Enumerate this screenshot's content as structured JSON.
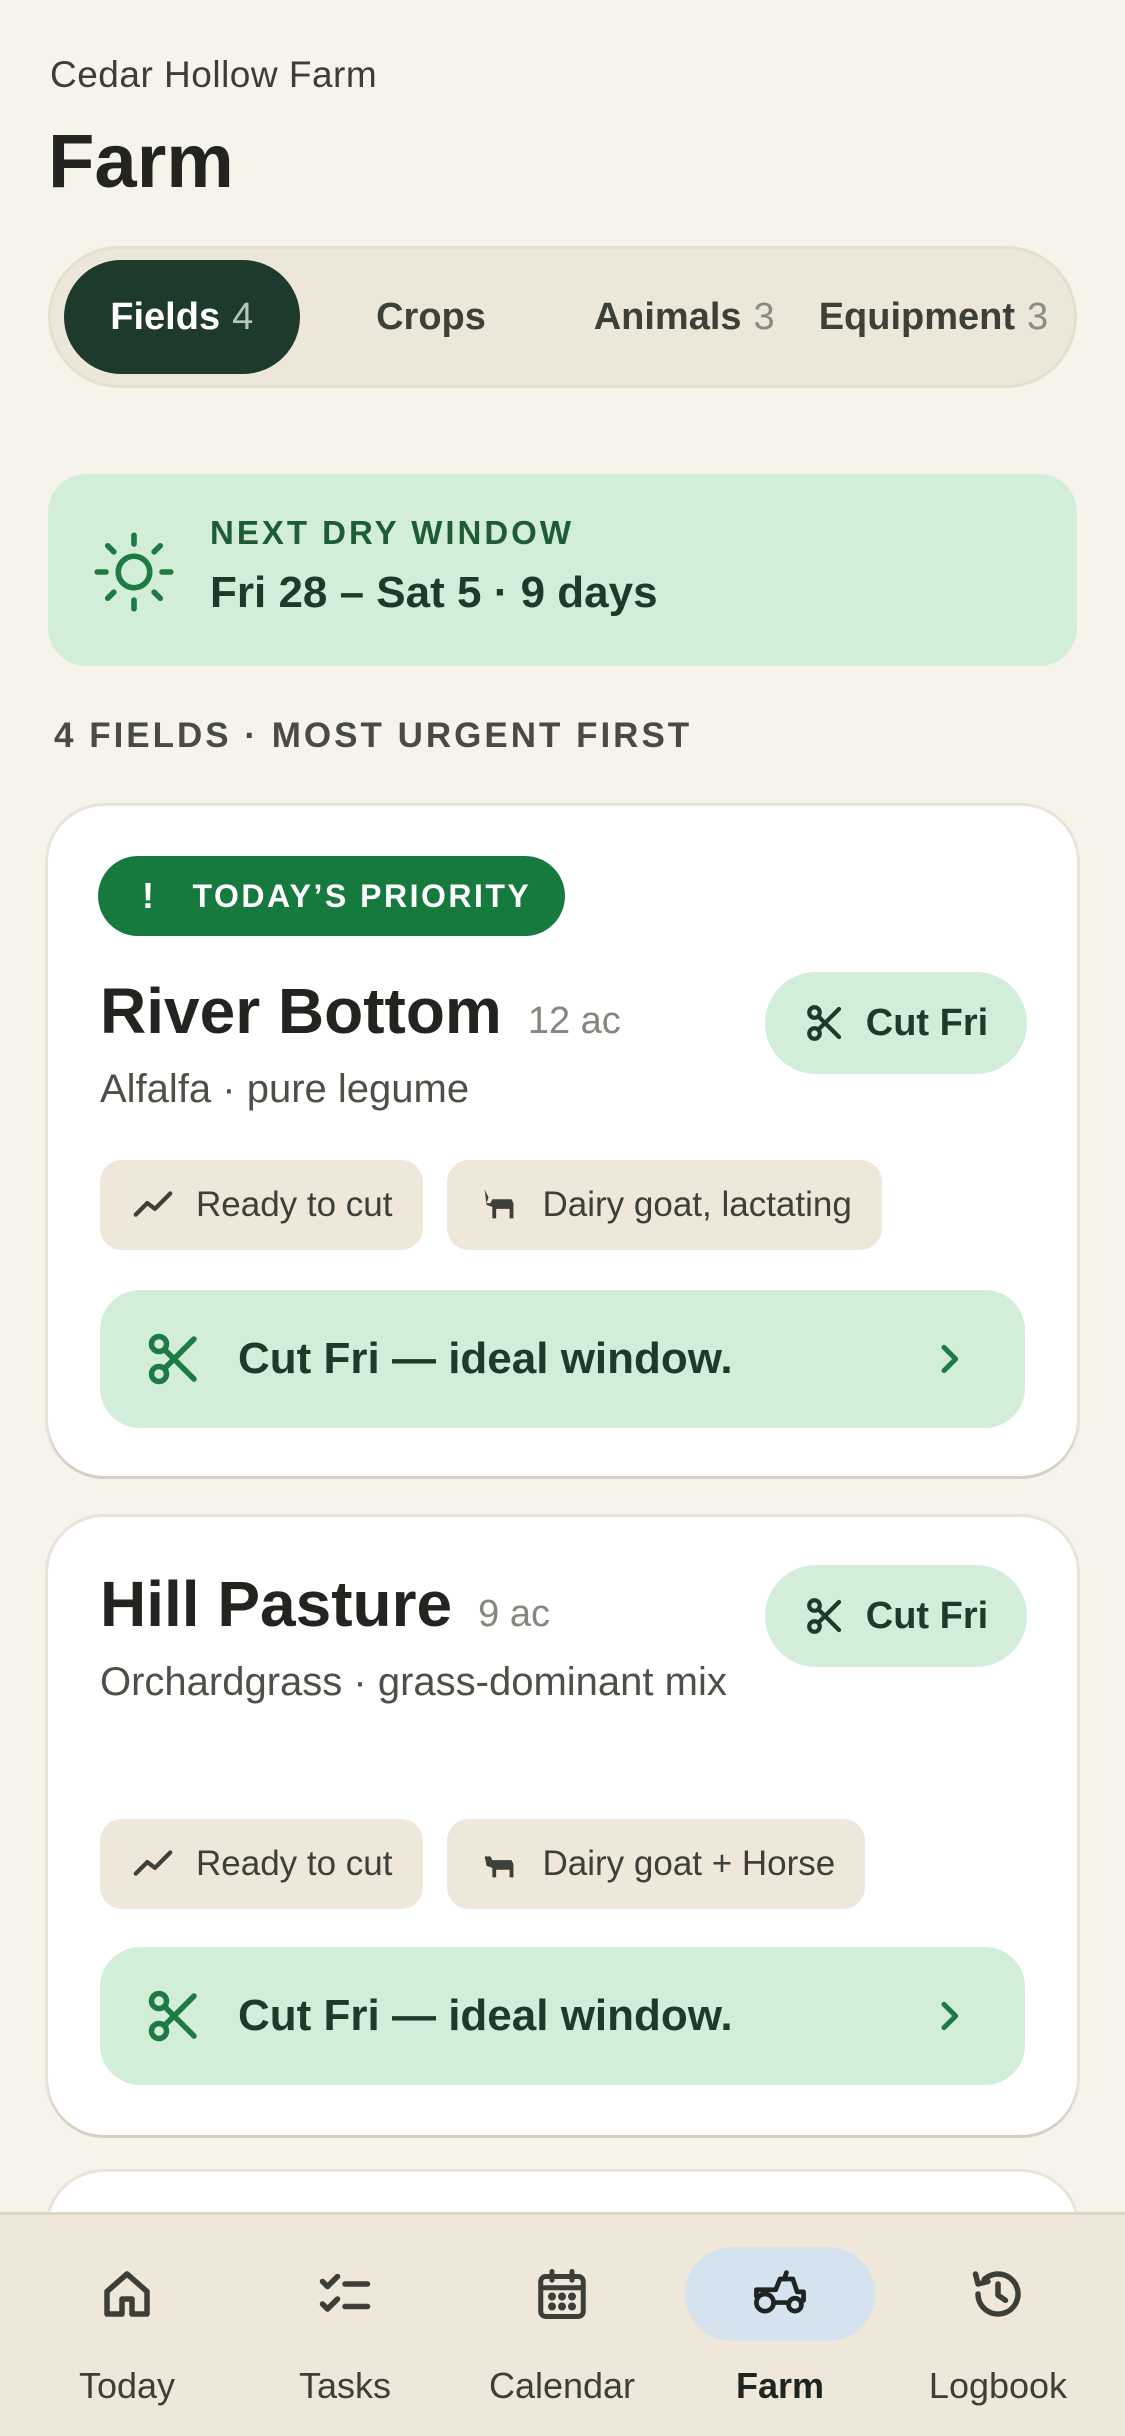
{
  "header": {
    "farm_name": "Cedar Hollow Farm",
    "title": "Farm"
  },
  "segments": [
    {
      "label": "Fields",
      "count": "4",
      "active": true
    },
    {
      "label": "Crops",
      "count": "",
      "active": false
    },
    {
      "label": "Animals",
      "count": "3",
      "active": false
    },
    {
      "label": "Equipment",
      "count": "3",
      "active": false
    }
  ],
  "dry_window": {
    "icon": "sun-icon",
    "label": "NEXT DRY WINDOW",
    "value": "Fri 28 – Sat 5 · 9 days"
  },
  "section_label": "4 FIELDS · MOST URGENT FIRST",
  "fields": [
    {
      "badge": "TODAY’S PRIORITY",
      "badge_mark": "!",
      "name": "River Bottom",
      "acres": "12 ac",
      "crop": "Alfalfa · pure legume",
      "pill": "Cut Fri",
      "chips": [
        {
          "icon": "trend-icon",
          "label": "Ready to cut"
        },
        {
          "icon": "goat-icon",
          "label": "Dairy goat, lactating"
        }
      ],
      "action": "Cut Fri — ideal window."
    },
    {
      "name": "Hill Pasture",
      "acres": "9 ac",
      "crop": "Orchardgrass · grass-dominant mix",
      "pill": "Cut Fri",
      "chips": [
        {
          "icon": "trend-icon",
          "label": "Ready to cut"
        },
        {
          "icon": "goat-icon",
          "label": "Dairy goat + Horse"
        }
      ],
      "action": "Cut Fri — ideal window."
    }
  ],
  "tabbar": [
    {
      "label": "Today",
      "icon": "home-icon",
      "active": false
    },
    {
      "label": "Tasks",
      "icon": "checklist-icon",
      "active": false
    },
    {
      "label": "Calendar",
      "icon": "calendar-icon",
      "active": false
    },
    {
      "label": "Farm",
      "icon": "tractor-icon",
      "active": true
    },
    {
      "label": "Logbook",
      "icon": "history-icon",
      "active": false
    }
  ],
  "colors": {
    "background": "#f6f3ea",
    "accent_dark": "#1e3a2c",
    "accent_green": "#167a3f",
    "mint": "#d3eed8",
    "chip": "#eee7da",
    "active_tab": "#d5e3ef"
  }
}
